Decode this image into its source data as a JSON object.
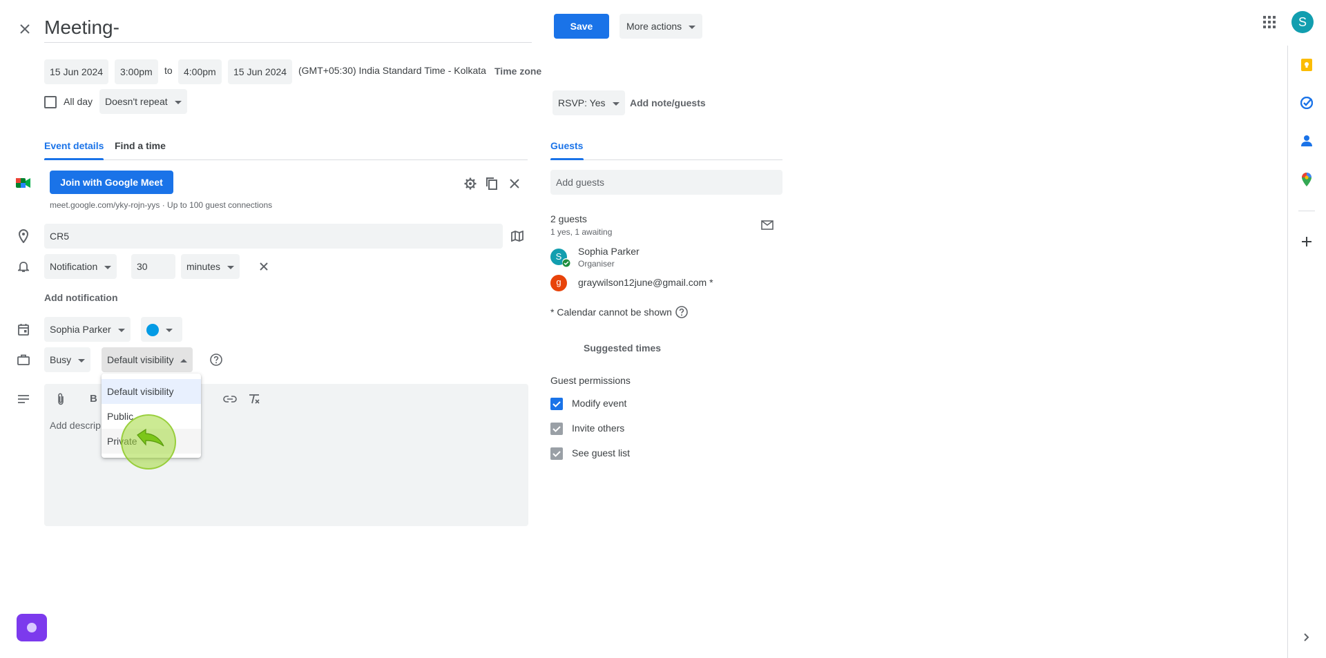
{
  "header": {
    "title": "Meeting-",
    "save_label": "Save",
    "more_actions_label": "More actions",
    "account_initial": "S",
    "account_color": "#129eaf"
  },
  "datetime": {
    "start_date": "15 Jun 2024",
    "start_time": "3:00pm",
    "to_label": "to",
    "end_time": "4:00pm",
    "end_date": "15 Jun 2024",
    "timezone": "(GMT+05:30) India Standard Time - Kolkata",
    "timezone_button": "Time zone",
    "all_day_label": "All day",
    "all_day_checked": false,
    "repeat_value": "Doesn't repeat"
  },
  "rsvp": {
    "value": "RSVP: Yes",
    "add_note_label": "Add note/guests"
  },
  "tabs": {
    "event_details": "Event details",
    "find_a_time": "Find a time",
    "guests": "Guests"
  },
  "meet": {
    "join_label": "Join with Google Meet",
    "link_info": "meet.google.com/yky-rojn-yys · Up to 100 guest connections"
  },
  "location": {
    "value": "CR5"
  },
  "notification": {
    "type": "Notification",
    "amount": "30",
    "unit": "minutes",
    "add_label": "Add notification"
  },
  "calendar": {
    "owner": "Sophia Parker",
    "color": "#039be5"
  },
  "availability": {
    "status": "Busy",
    "visibility": "Default visibility"
  },
  "visibility_menu": {
    "options": [
      "Default visibility",
      "Public",
      "Private"
    ],
    "selected_index": 0
  },
  "description": {
    "placeholder": "Add descrip"
  },
  "guests": {
    "add_placeholder": "Add guests",
    "count_label": "2 guests",
    "summary": "1 yes, 1 awaiting",
    "list": [
      {
        "initial": "S",
        "name": "Sophia Parker",
        "role": "Organiser",
        "color": "#129eaf"
      },
      {
        "initial": "g",
        "name": "graywilson12june@gmail.com *",
        "role": "",
        "color": "#e8430a"
      }
    ],
    "calendar_note": "* Calendar cannot be shown",
    "suggested_times": "Suggested times",
    "permissions_title": "Guest permissions",
    "permissions": [
      {
        "label": "Modify event",
        "checked": true
      },
      {
        "label": "Invite others",
        "checked": true
      },
      {
        "label": "See guest list",
        "checked": true
      }
    ]
  },
  "colors": {
    "accent": "#1a73e8",
    "field_bg": "#f1f3f4",
    "cursor_highlight": "#a3d93a",
    "assistant_button": "#7c3aed"
  }
}
